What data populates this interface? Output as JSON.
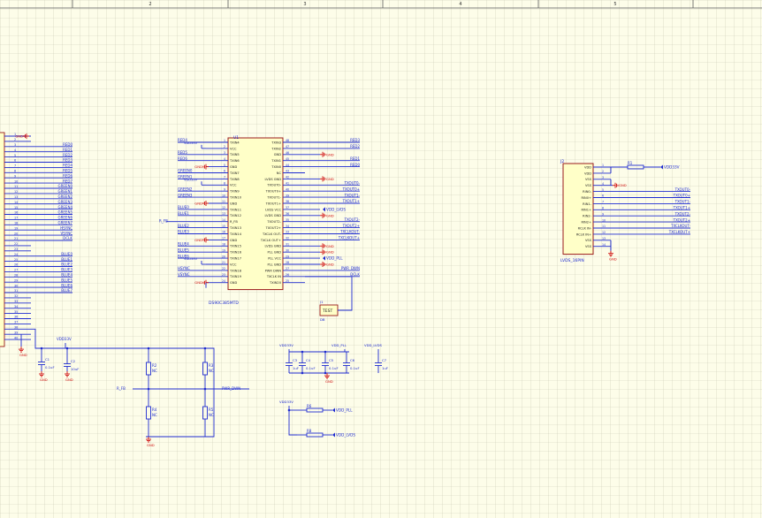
{
  "frame": {
    "zone_numbers": [
      "2",
      "3",
      "4",
      "5"
    ]
  },
  "left_connector": {
    "pin_numbers": [
      "1",
      "2",
      "3",
      "4",
      "5",
      "6",
      "7",
      "8",
      "9",
      "10",
      "11",
      "12",
      "13",
      "14",
      "15",
      "16",
      "17",
      "18",
      "19",
      "20",
      "21",
      "22",
      "23",
      "24",
      "25",
      "26",
      "27",
      "28",
      "29",
      "30",
      "31",
      "32",
      "33",
      "34",
      "35",
      "36",
      "37",
      "38",
      "39",
      "40"
    ],
    "nets": [
      "GND",
      "",
      "RED0",
      "RED1",
      "RED2",
      "RED3",
      "RED4",
      "RED5",
      "RED6",
      "RED7",
      "GREEN0",
      "GREEN1",
      "GREEN2",
      "GREEN3",
      "GREEN4",
      "GREEN5",
      "GREEN6",
      "GREEN7",
      "HSYNC",
      "VSYNC",
      "DCLK",
      "",
      "",
      "BLUE0",
      "BLUE1",
      "BLUE2",
      "BLUE3",
      "BLUE4",
      "BLUE5",
      "BLUE6",
      "BLUE7",
      "",
      "",
      "",
      "",
      "",
      "",
      "",
      "",
      ""
    ]
  },
  "serializer": {
    "designator": "U1",
    "part": "DS90C385MTD",
    "left_pins": [
      "TXIN4",
      "VCC",
      "TXIN5",
      "TXIN6",
      "GND",
      "TXIN7",
      "TXIN8",
      "VCC",
      "TXIN9",
      "TXIN10",
      "GND",
      "TXIN11",
      "TXIN12",
      "R_FB",
      "TXIN13",
      "TXIN14",
      "GND",
      "TXIN15",
      "TXIN16",
      "TXIN17",
      "VCC",
      "TXIN18",
      "TXIN19",
      "GND"
    ],
    "right_pins": [
      "TXIN3",
      "TXIN2",
      "GND",
      "TXIN1",
      "TXIN0",
      "NC",
      "LVDS GND",
      "TXOUT0-",
      "TXOUT0+",
      "TXOUT1-",
      "TXOUT1+",
      "LVDS VCC",
      "LVDS GND",
      "TXOUT2-",
      "TXOUT2+",
      "TXCLK OUT-",
      "TXCLK OUT+",
      "LVDS GND",
      "PLL GND",
      "PLL VCC",
      "PLL GND",
      "PWR DWN",
      "TXCLK IN",
      "TXIN20"
    ],
    "left_numbers": [
      "1",
      "2",
      "3",
      "4",
      "5",
      "6",
      "7",
      "8",
      "9",
      "10",
      "11",
      "12",
      "13",
      "14",
      "15",
      "16",
      "17",
      "18",
      "19",
      "20",
      "21",
      "22",
      "23",
      "24"
    ],
    "right_numbers": [
      "48",
      "47",
      "46",
      "45",
      "44",
      "43",
      "42",
      "41",
      "40",
      "39",
      "38",
      "37",
      "36",
      "35",
      "34",
      "33",
      "32",
      "31",
      "30",
      "29",
      "28",
      "27",
      "26",
      "25"
    ],
    "left_nets": [
      "RED4",
      "VDD33V",
      "RED5",
      "RED6",
      "GND",
      "GREEN0",
      "GREEN1",
      "VDD33V",
      "GREEN2",
      "GREEN3",
      "GND",
      "BLUE0",
      "BLUE1",
      "R_FB",
      "BLUE2",
      "BLUE3",
      "GND",
      "BLUE4",
      "BLUE5",
      "BLUE6",
      "VDD33V",
      "HSYNC",
      "VSYNC",
      "GND"
    ],
    "right_nets": [
      "RED3",
      "RED2",
      "GND",
      "RED1",
      "RED0",
      "",
      "GND",
      "TXOUT0-",
      "TXOUT0+",
      "TXOUT1-",
      "TXOUT1+",
      "VDD_LVDS",
      "GND",
      "TXOUT2-",
      "TXOUT2+",
      "TXCLKOUT-",
      "TXCLKOUT+",
      "GND",
      "GND",
      "VDD_PLL",
      "GND",
      "PWR_DWN",
      "DCLK",
      ""
    ]
  },
  "lvds_connector": {
    "designator": "J2",
    "part": "LVDS_16PIN",
    "pins": [
      "VDD",
      "VDD",
      "VSS",
      "VSS",
      "RIN0-",
      "RIN0+",
      "RIN1-",
      "RIN1+",
      "RIN2-",
      "RIN2+",
      "RCLK IN-",
      "RCLK IN+",
      "VSS",
      "VSS"
    ],
    "numbers": [
      "1",
      "2",
      "3",
      "4",
      "5",
      "6",
      "7",
      "8",
      "9",
      "10",
      "11",
      "12",
      "13",
      "14"
    ],
    "nets": [
      "",
      "",
      "",
      "",
      "TXOUT0-",
      "TXOUT0+",
      "TXOUT1-",
      "TXOUT1+",
      "TXOUT2-",
      "TXOUT2+",
      "TXCLKOUT-",
      "TXCLKOUT+",
      "",
      ""
    ],
    "resistor": "R1",
    "supply": "VDD33V"
  },
  "test_point": {
    "designator": "J1",
    "label": "TEST",
    "part": "DB"
  },
  "power": {
    "gnd": "GND",
    "vdd33": "VDD33V",
    "vdd_pll": "VDD_PLL",
    "vdd_lvds": "VDD_LVDS"
  },
  "left_bypass": {
    "c1": "C1",
    "c1_value": "0.1uF",
    "c2": "C2",
    "c2_value": "10uF"
  },
  "bias_network": {
    "net_left": "R_FB",
    "net_right": "PWR_DWN",
    "r2": "R2",
    "r3": "R3",
    "r4": "R4",
    "r5": "R5",
    "nc": "NC"
  },
  "decoupling": {
    "caps": [
      "C3",
      "C4",
      "C5",
      "C6",
      "C7"
    ],
    "values": [
      "1uF",
      "0.1uF",
      "0.1uF",
      "0.1uF",
      "1uF"
    ]
  },
  "filters": {
    "r_pll": "R6",
    "r_lvds": "R8"
  },
  "colors": {
    "background": "#fdfde9",
    "grid": "#c8c8b0",
    "wire": "#1e2bd0",
    "power": "#d01010",
    "part_fill": "#ffffc8",
    "part_border": "#9a1a1a"
  }
}
